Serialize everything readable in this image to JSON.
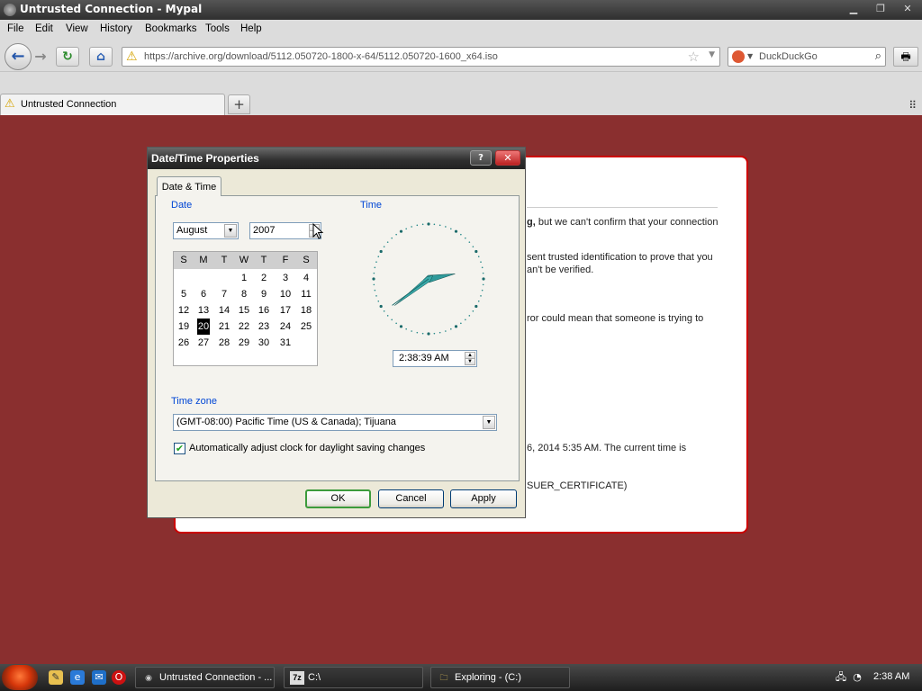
{
  "window": {
    "title": "Untrusted Connection - Mypal",
    "min": "▁",
    "restore": "❐",
    "close": "✕"
  },
  "menu": [
    "File",
    "Edit",
    "View",
    "History",
    "Bookmarks",
    "Tools",
    "Help"
  ],
  "nav": {
    "url": "https://archive.org/download/5112.050720-1800-x-64/5112.050720-1600_x64.iso",
    "search_placeholder": "DuckDuckGo",
    "back_icon": "back-arrow-icon",
    "forward_icon": "forward-arrow-icon",
    "reload_icon": "reload-icon",
    "home_icon": "home-icon"
  },
  "tabs": [
    {
      "label": "Untrusted Connection",
      "icon": "warning-icon"
    }
  ],
  "error_page": {
    "line1_bold": "g,",
    "line1": " but we can't confirm that your connection",
    "line2": "sent trusted identification to prove that you",
    "line3": "an't be verified.",
    "line4": "ror could mean that someone is trying to",
    "line5": "6, 2014 5:35 AM. The current time is",
    "line6": "SUER_CERTIFICATE)"
  },
  "dialog": {
    "title": "Date/Time Properties",
    "help": "?",
    "close": "✕",
    "tab": "Date & Time",
    "date_label": "Date",
    "time_label": "Time",
    "month": "August",
    "year": "2007",
    "weekday_headers": [
      "S",
      "M",
      "T",
      "W",
      "T",
      "F",
      "S"
    ],
    "weeks": [
      [
        "",
        "",
        "",
        "1",
        "2",
        "3",
        "4"
      ],
      [
        "5",
        "6",
        "7",
        "8",
        "9",
        "10",
        "11"
      ],
      [
        "12",
        "13",
        "14",
        "15",
        "16",
        "17",
        "18"
      ],
      [
        "19",
        "20",
        "21",
        "22",
        "23",
        "24",
        "25"
      ],
      [
        "26",
        "27",
        "28",
        "29",
        "30",
        "31",
        ""
      ]
    ],
    "selected_day": "20",
    "time_value": "2:38:39 AM",
    "clock": {
      "hour": 2,
      "minute": 38,
      "second": 39
    },
    "timezone_label": "Time zone",
    "timezone": "(GMT-08:00) Pacific Time (US & Canada); Tijuana",
    "dst_checked": true,
    "dst_label": "Automatically adjust clock for daylight saving changes",
    "ok": "OK",
    "cancel": "Cancel",
    "apply": "Apply"
  },
  "taskbar": {
    "tasks": [
      {
        "label": "Untrusted Connection - ...",
        "icon": "browser-icon"
      },
      {
        "label": "C:\\",
        "icon": "7zip-icon",
        "icon_text": "7z"
      },
      {
        "label": "Exploring - (C:)",
        "icon": "explorer-icon"
      }
    ],
    "clock": "2:38 AM"
  }
}
